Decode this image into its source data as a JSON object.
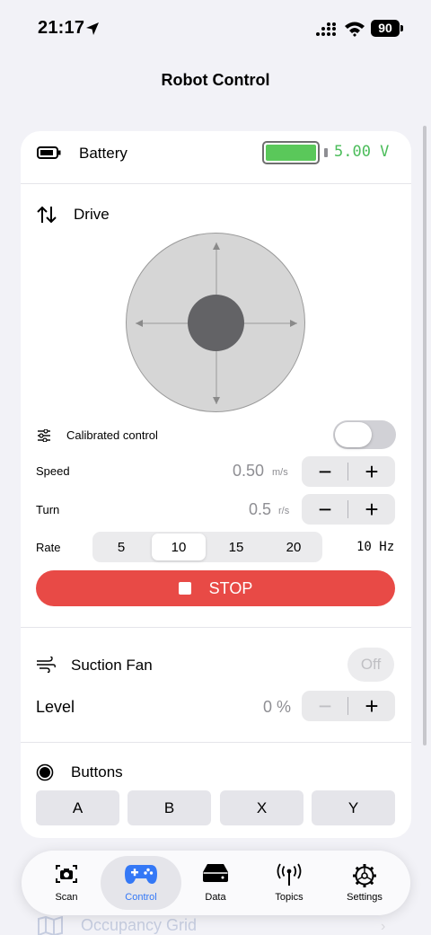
{
  "status_bar": {
    "time": "21:17",
    "battery_level": "90",
    "icons": [
      "location-arrow-icon",
      "cellular-signal-icon",
      "wifi-icon",
      "battery-icon"
    ]
  },
  "nav": {
    "title": "Robot Control"
  },
  "battery": {
    "label": "Battery",
    "voltage": "5.00 V",
    "level_fraction": 1.0,
    "color": "#5ac85a"
  },
  "drive": {
    "title": "Drive",
    "calibrated_control": {
      "label": "Calibrated control",
      "enabled": false
    },
    "speed": {
      "label": "Speed",
      "value": "0.50",
      "unit": "m/s"
    },
    "turn": {
      "label": "Turn",
      "value": "0.5",
      "unit": "r/s"
    },
    "rate": {
      "label": "Rate",
      "options": [
        "5",
        "10",
        "15",
        "20"
      ],
      "selected": "10",
      "readout": "10 Hz"
    },
    "stop_label": "STOP",
    "stop_color": "#e84a46"
  },
  "suction_fan": {
    "title": "Suction Fan",
    "toggle_label": "Off",
    "level": {
      "label": "Level",
      "value": "0 %"
    }
  },
  "buttons": {
    "title": "Buttons",
    "items": [
      "A",
      "B",
      "X",
      "Y"
    ]
  },
  "background_list": {
    "item": "Occupancy Grid"
  },
  "tabbar": {
    "tabs": [
      {
        "label": "Scan",
        "icon": "camera-icon"
      },
      {
        "label": "Control",
        "icon": "gamepad-icon",
        "selected": true
      },
      {
        "label": "Data",
        "icon": "drive-icon"
      },
      {
        "label": "Topics",
        "icon": "antenna-icon"
      },
      {
        "label": "Settings",
        "icon": "gear-icon"
      }
    ],
    "accent": "#3478f6"
  }
}
